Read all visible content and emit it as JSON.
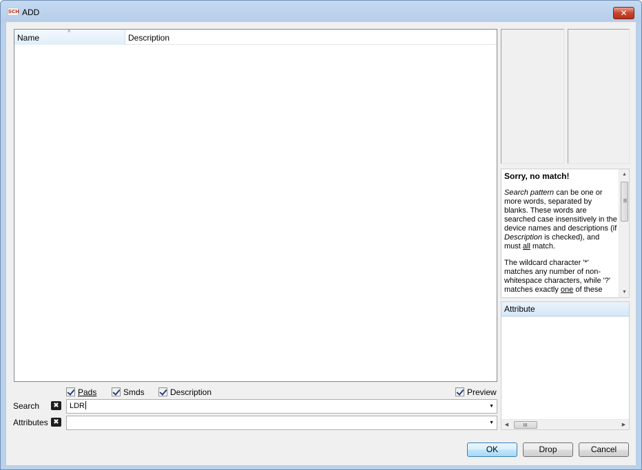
{
  "window": {
    "title": "ADD",
    "icon_text": "SCH",
    "close_glyph": "✕"
  },
  "list": {
    "columns": [
      "Name",
      "Description"
    ],
    "sort_glyph": "˄",
    "rows": []
  },
  "help": {
    "title": "Sorry, no match!",
    "para1_em1": "Search pattern",
    "para1_text1": " can be one or more words, separated by blanks. These words are searched case insensitively in the device names and descriptions (if ",
    "para1_em2": "Description",
    "para1_text2": " is checked), and must ",
    "para1_u": "all",
    "para1_text3": " match.",
    "para2_text1": "The wildcard character '*' matches any number of non-whitespace characters, while '?' matches exactly ",
    "para2_u": "one",
    "para2_text2": " of these"
  },
  "attributes": {
    "header": "Attribute",
    "rows": []
  },
  "options": {
    "pads": {
      "label": "Pads",
      "checked": true
    },
    "smds": {
      "label": "Smds",
      "checked": true
    },
    "description": {
      "label": "Description",
      "checked": true
    },
    "preview": {
      "label": "Preview",
      "checked": true
    }
  },
  "search": {
    "label": "Search",
    "value": "LDR",
    "clear_glyph": "✖",
    "arrow": "▼"
  },
  "attr_filter": {
    "label": "Attributes",
    "value": "",
    "clear_glyph": "✖",
    "arrow": "▼"
  },
  "buttons": {
    "ok": "OK",
    "drop": "Drop",
    "cancel": "Cancel"
  },
  "scroll_glyphs": {
    "up": "▲",
    "down": "▼",
    "left": "◀",
    "right": "▶"
  }
}
